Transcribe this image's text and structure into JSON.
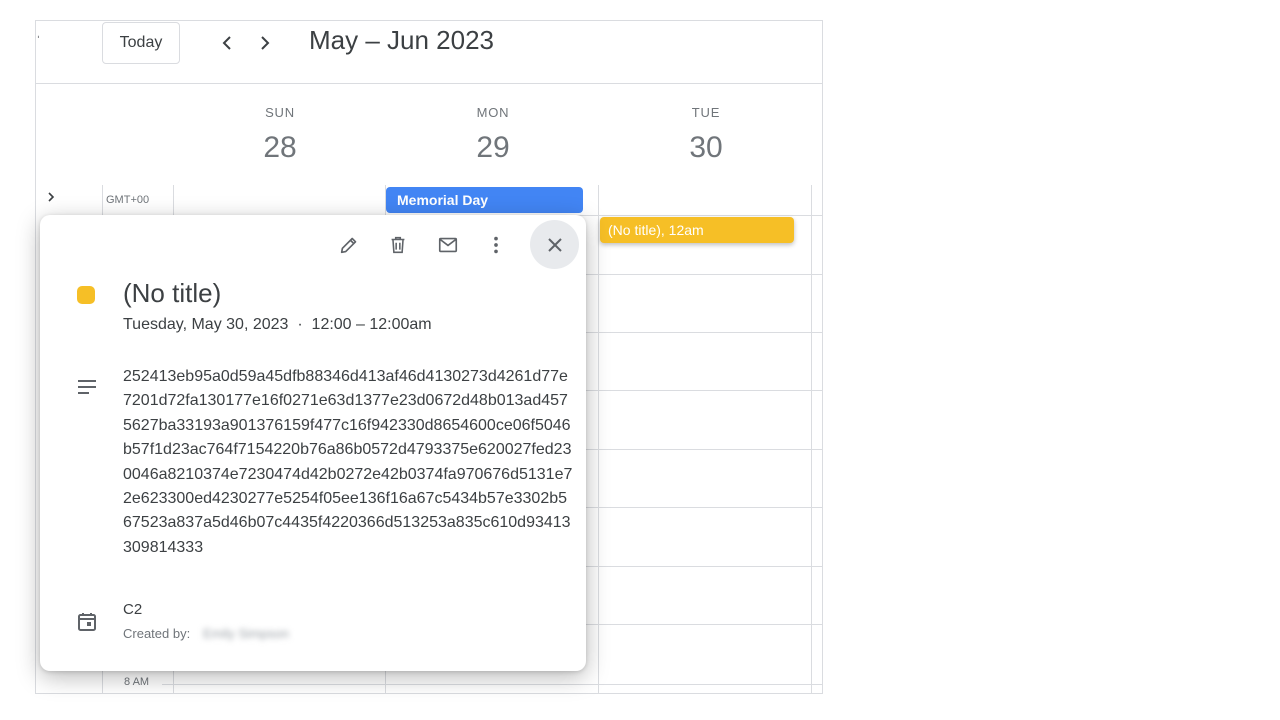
{
  "header": {
    "today_label": "Today",
    "period_title": "May – Jun 2023"
  },
  "days": [
    {
      "name": "SUN",
      "number": "28"
    },
    {
      "name": "MON",
      "number": "29"
    },
    {
      "name": "TUE",
      "number": "30"
    }
  ],
  "timezone_label": "GMT+00",
  "time_label_8am": "8 AM",
  "events": {
    "memorial_day": "Memorial Day",
    "no_title_chip": "(No title), 12am"
  },
  "popup": {
    "title": "(No title)",
    "date_time": "Tuesday, May 30, 2023  ·  12:00 – 12:00am",
    "description": "252413eb95a0d59a45dfb88346d413af46d4130273d4261d77e7201d72fa130177e16f0271e63d1377e23d0672d48b013ad4575627ba33193a901376159f477c16f942330d8654600ce06f5046b57f1d23ac764f7154220b76a86b0572d4793375e620027fed230046a8210374e7230474d42b0272e42b0374fa970676d5131e72e623300ed4230277e5254f05ee136f16a67c5434b57e3302b567523a837a5d46b07c4435f4220366d513253a835c610d93413309814333",
    "calendar_name": "C2",
    "created_by_label": "Created by:",
    "created_by_name": "Emily Simpson",
    "event_color": "#f6bf26"
  },
  "colors": {
    "memorial_day": "#4285f4",
    "no_title_event": "#f6bf26"
  },
  "icons": [
    "edit-icon",
    "delete-icon",
    "email-icon",
    "more-vert-icon",
    "close-icon",
    "description-icon",
    "calendar-icon",
    "chevron-left-icon",
    "chevron-right-icon"
  ]
}
